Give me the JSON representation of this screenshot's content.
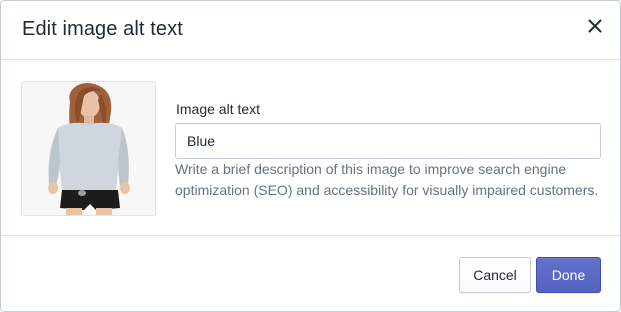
{
  "dialog": {
    "title": "Edit image alt text",
    "close_icon": "close-icon"
  },
  "field": {
    "label": "Image alt text",
    "value": "Blue",
    "help": "Write a brief description of this image to improve search engine optimization (SEO) and accessibility for visually impaired customers."
  },
  "footer": {
    "cancel_label": "Cancel",
    "done_label": "Done"
  },
  "colors": {
    "primary": "#5c6ac4",
    "border": "#c4cdd5",
    "help_text": "#637381"
  }
}
